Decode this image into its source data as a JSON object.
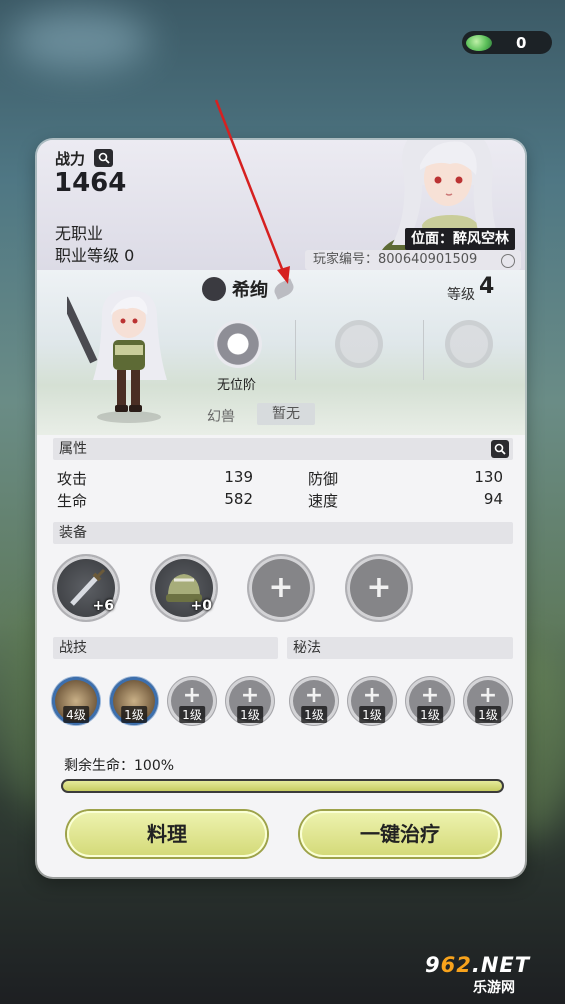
{
  "currency": {
    "icon": "green-gem-icon",
    "count": "0"
  },
  "header": {
    "power_label": "战力",
    "power_value": "1464",
    "job_label": "无职业",
    "job_level": "职业等级 0",
    "location_tag": "位面：醉风空林",
    "player_id": "玩家编号：800640901509"
  },
  "pet": {
    "name": "希绚",
    "level_label": "等级",
    "level_value": "4",
    "rank_label": "无位阶",
    "beast_label": "幻兽",
    "beast_value": "暂无"
  },
  "attributes": {
    "title": "属性",
    "stats": [
      {
        "label": "攻击",
        "value": "139"
      },
      {
        "label": "防御",
        "value": "130"
      },
      {
        "label": "生命",
        "value": "582"
      },
      {
        "label": "速度",
        "value": "94"
      }
    ]
  },
  "equipment": {
    "title": "装备",
    "slots": [
      {
        "icon": "sword-icon",
        "badge": "+6"
      },
      {
        "icon": "helmet-icon",
        "badge": "+0"
      },
      {
        "icon": "plus-icon",
        "badge": ""
      },
      {
        "icon": "plus-icon",
        "badge": ""
      }
    ]
  },
  "skills": {
    "title": "战技",
    "slots": [
      {
        "icon": "skill-slash-icon",
        "badge": "4级"
      },
      {
        "icon": "skill-strike-icon",
        "badge": "1级"
      },
      {
        "icon": "plus-icon",
        "badge": "1级"
      },
      {
        "icon": "plus-icon",
        "badge": "1级"
      }
    ]
  },
  "secrets": {
    "title": "秘法",
    "slots": [
      {
        "icon": "plus-icon",
        "badge": "1级"
      },
      {
        "icon": "plus-icon",
        "badge": "1级"
      },
      {
        "icon": "plus-icon",
        "badge": "1级"
      },
      {
        "icon": "plus-icon",
        "badge": "1级"
      }
    ]
  },
  "health": {
    "label": "剩余生命：100%",
    "fraction": 1.0
  },
  "buttons": {
    "cook": "料理",
    "heal_all": "一键治疗"
  },
  "watermark": {
    "top_prefix": "9",
    "top_num": "62",
    "top_suffix": ".NET",
    "bottom": "乐游网"
  },
  "colors": {
    "accent": "#d3d977",
    "panel": "#f4f4f6",
    "dark": "#1e1e22"
  }
}
